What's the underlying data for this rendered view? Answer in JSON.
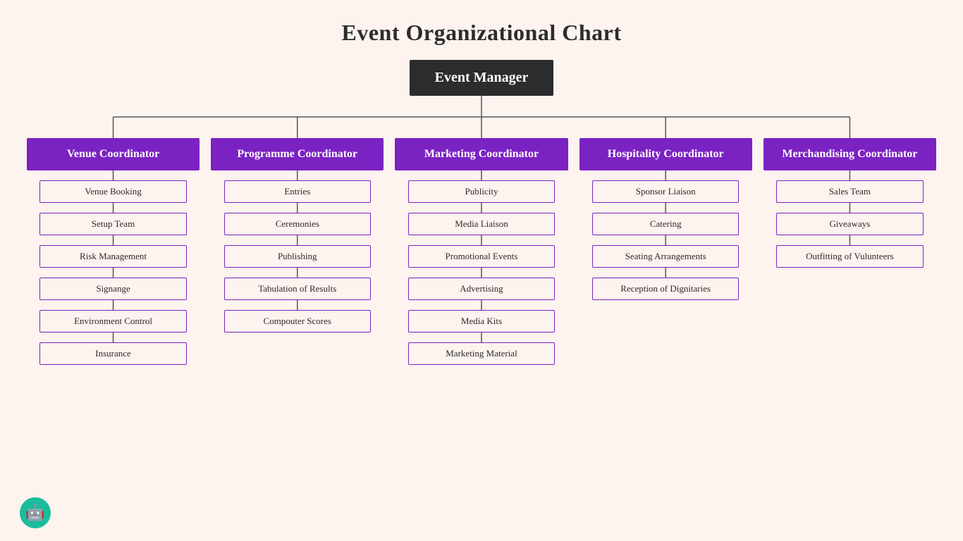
{
  "title": "Event Organizational Chart",
  "root": "Event Manager",
  "coordinators": [
    {
      "id": "venue",
      "label": "Venue Coordinator",
      "children": [
        "Venue Booking",
        "Setup Team",
        "Risk Management",
        "Signange",
        "Environment Control",
        "Insurance"
      ]
    },
    {
      "id": "programme",
      "label": "Programme Coordinator",
      "children": [
        "Entries",
        "Ceremonies",
        "Publishing",
        "Tabulation of Results",
        "Compouter Scores"
      ]
    },
    {
      "id": "marketing",
      "label": "Marketing Coordinator",
      "children": [
        "Publicity",
        "Media Liaison",
        "Promotional Events",
        "Advertising",
        "Media Kits",
        "Marketing Material"
      ]
    },
    {
      "id": "hospitality",
      "label": "Hospitality Coordinator",
      "children": [
        "Sponsor Liaison",
        "Catering",
        "Seating Arrangements",
        "Reception of Dignitaries"
      ]
    },
    {
      "id": "merchandising",
      "label": "Merchandising Coordinator",
      "children": [
        "Sales Team",
        "Giveaways",
        "Outfitting of Vulunteers"
      ]
    }
  ],
  "robot_icon": "🤖"
}
